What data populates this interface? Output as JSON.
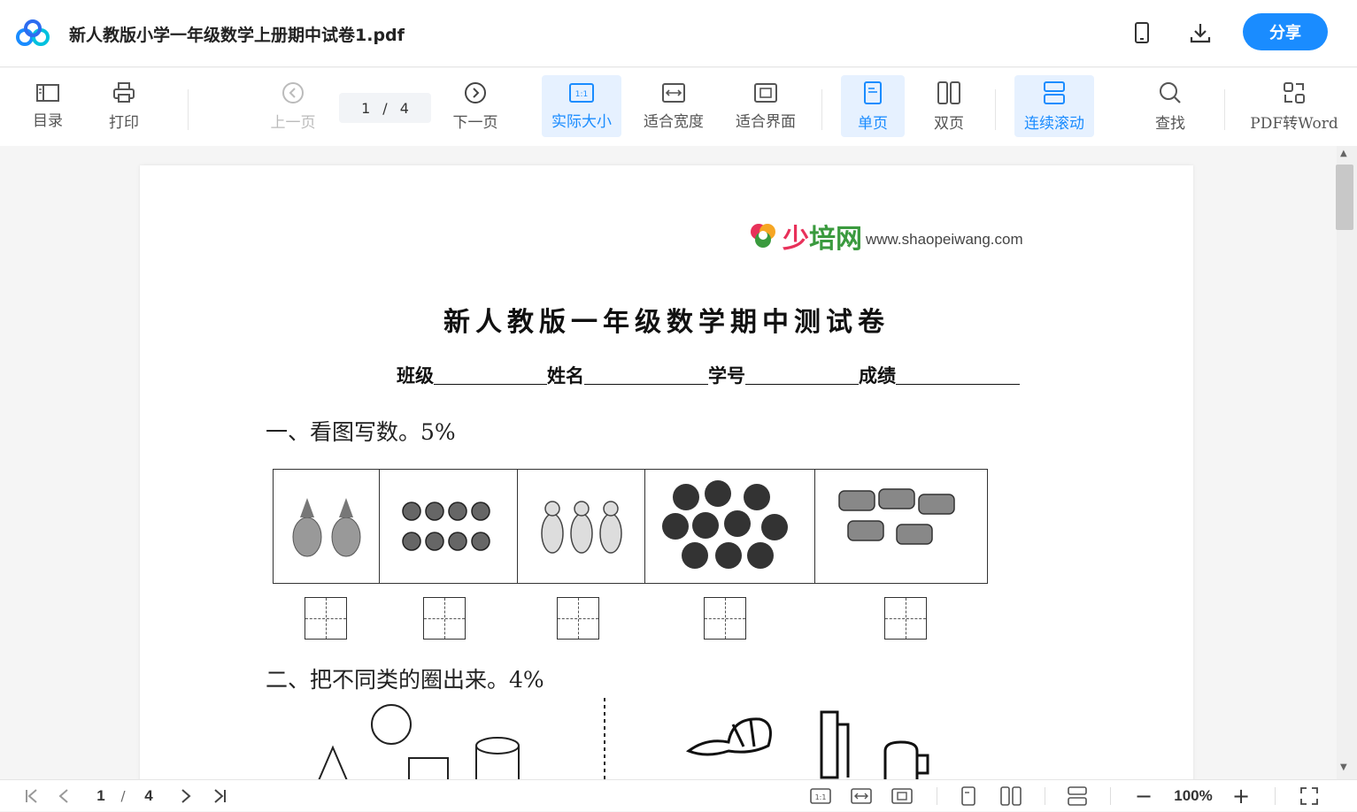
{
  "app": {
    "doc_title": "新人教版小学一年级数学上册期中试卷1.pdf",
    "share_label": "分享"
  },
  "toolbar": {
    "toc": "目录",
    "print": "打印",
    "prev": "上一页",
    "page_current": "1",
    "page_sep": "/",
    "page_total": "4",
    "next": "下一页",
    "actual_size": "实际大小",
    "fit_width": "适合宽度",
    "fit_page": "适合界面",
    "single": "单页",
    "double": "双页",
    "continuous": "连续滚动",
    "find": "查找",
    "pdf_to_word": "PDF转Word"
  },
  "document": {
    "brand_cn": "少培网",
    "brand_url": "www.shaopeiwang.com",
    "title": "新人教版一年级数学期中测试卷",
    "info_labels": [
      "班级",
      "姓名",
      "学号",
      "成绩"
    ],
    "q1": "一、看图写数。5%",
    "q2": "二、把不同类的圈出来。4%"
  },
  "bottombar": {
    "page_current": "1",
    "page_sep": "/",
    "page_total": "4",
    "zoom": "100%"
  },
  "colors": {
    "accent": "#1a8cff",
    "active_bg": "#e6f1ff",
    "brand_red": "#e8315a",
    "brand_green": "#3a9a3e"
  }
}
